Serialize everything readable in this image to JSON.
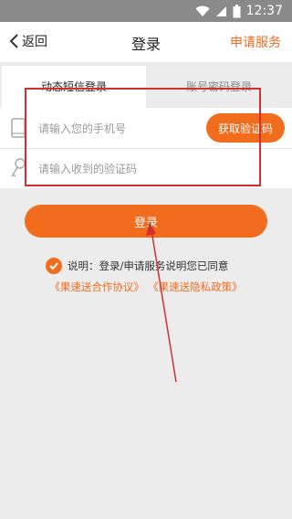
{
  "status_bar": {
    "time": "12:37"
  },
  "nav": {
    "back_label": "返回",
    "title": "登录",
    "action_label": "申请服务"
  },
  "tabs": {
    "sms_login": "动态短信登录",
    "password_login": "账号密码登录"
  },
  "form": {
    "phone_placeholder": "请输入您的手机号",
    "get_code_label": "获取验证码",
    "code_placeholder": "请输入收到的验证码"
  },
  "login_button": "登录",
  "agreement": {
    "text": "说明：登录/申请服务说明您已同意",
    "checked": true,
    "link_1": "《果速送合作协议》",
    "link_2": "《果速送隐私政策》"
  },
  "colors": {
    "accent": "#f26c1e",
    "annotation": "#d32f2f",
    "statusbar": "#8a8a8a"
  },
  "icons": [
    "wifi-icon",
    "signal-icon",
    "battery-icon",
    "back-chevron-icon",
    "phone-icon",
    "key-icon",
    "check-icon"
  ]
}
